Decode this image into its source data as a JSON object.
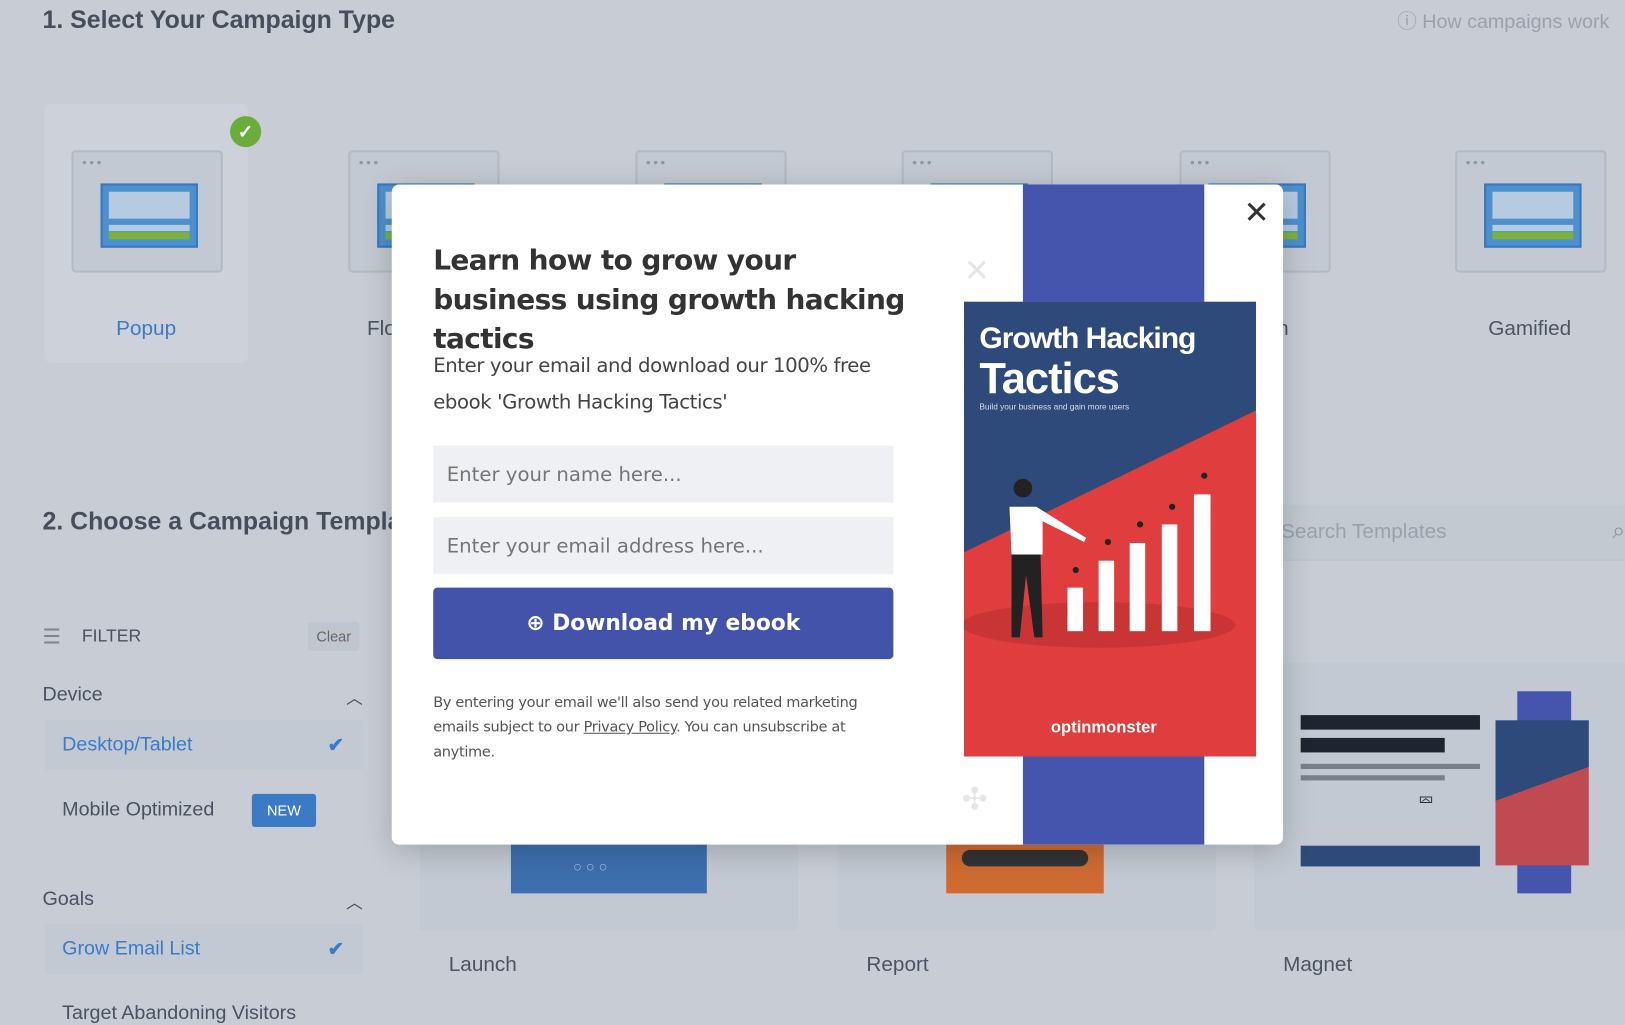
{
  "section1": {
    "title": "1. Select Your Campaign Type",
    "help_link": "How campaigns work"
  },
  "campaign_types": [
    {
      "label": "Popup",
      "selected": true
    },
    {
      "label": "Floating Bar"
    },
    {
      "label": ""
    },
    {
      "label": ""
    },
    {
      "label": "Slide-in"
    },
    {
      "label": "Gamified"
    }
  ],
  "section2": {
    "title": "2. Choose a Campaign Template",
    "search_placeholder": "Search Templates"
  },
  "filter": {
    "label": "FILTER",
    "clear": "Clear",
    "device": {
      "heading": "Device",
      "items": [
        {
          "label": "Desktop/Tablet",
          "selected": true
        },
        {
          "label": "Mobile Optimized",
          "badge": "NEW"
        }
      ]
    },
    "goals": {
      "heading": "Goals",
      "items": [
        {
          "label": "Grow Email List",
          "selected": true
        },
        {
          "label": "Target Abandoning Visitors"
        }
      ]
    }
  },
  "templates": [
    {
      "name": "Launch"
    },
    {
      "name": "Report"
    },
    {
      "name": "Magnet"
    }
  ],
  "modal": {
    "heading": "Learn how to grow your business using growth hacking tactics",
    "body": "Enter your email and download our 100% free ebook 'Growth Hacking Tactics'",
    "name_placeholder": "Enter your name here...",
    "email_placeholder": "Enter your email address here...",
    "button": "Download my ebook",
    "disclaimer_pre": "By entering your email we'll also send you related marketing emails subject to our ",
    "privacy_link": "Privacy Policy",
    "disclaimer_post": ". You can unsubscribe at anytime.",
    "book": {
      "title1": "Growth Hacking",
      "title2": "Tactics",
      "subtitle": "Build your business and gain more users",
      "brand": "optinmonster"
    }
  },
  "colors": {
    "accent": "#4353aa",
    "selected_blue": "#3b7bc6",
    "success": "#6aad3a",
    "book_navy": "#2e4a7a",
    "book_red": "#e03e3e"
  }
}
